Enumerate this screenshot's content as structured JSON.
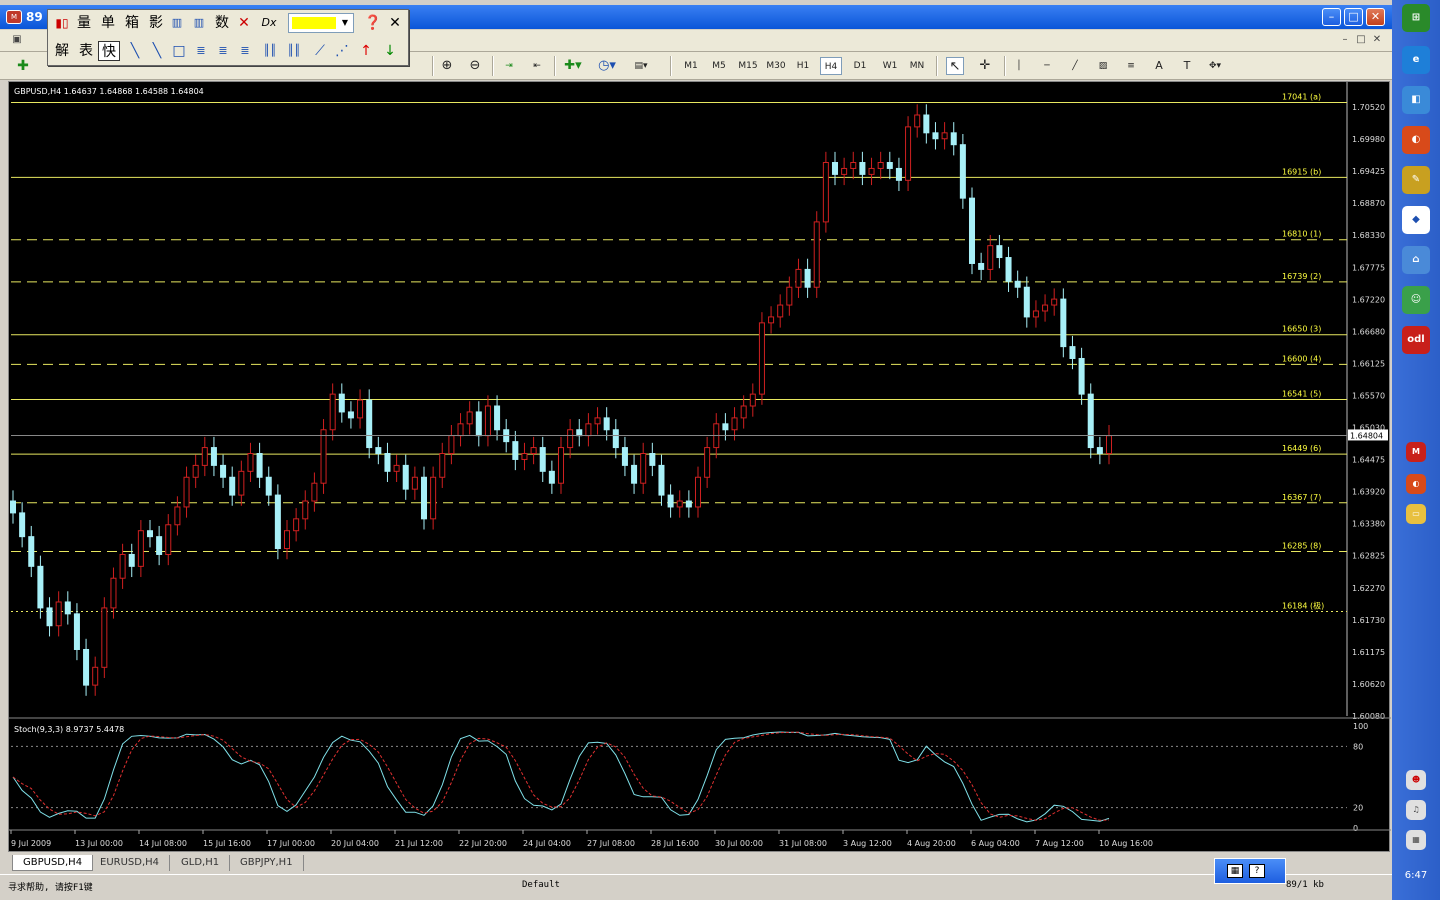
{
  "window": {
    "title": "89",
    "min": "–",
    "max": "□",
    "close": "✕"
  },
  "mdi": {
    "min": "–",
    "max": "□",
    "close": "✕"
  },
  "toolbar": {
    "timeframes": [
      "M1",
      "M5",
      "M15",
      "M30",
      "H1",
      "H4",
      "D1",
      "W1",
      "MN"
    ],
    "active_timeframe": "H4"
  },
  "float_toolbar": {
    "row1": [
      "量",
      "单",
      "箱",
      "影",
      "数"
    ],
    "row2": [
      "解",
      "表",
      "快"
    ],
    "active_row2": "快",
    "color": "#ffff00"
  },
  "chart": {
    "symbol_info": "GBPUSD,H4  1.64637 1.64868 1.64588 1.64804",
    "current_price": "1.64804",
    "price_axis": [
      "1.70520",
      "1.69980",
      "1.69425",
      "1.68870",
      "1.68330",
      "1.67775",
      "1.67220",
      "1.66680",
      "1.66125",
      "1.65570",
      "1.65030",
      "1.64475",
      "1.63920",
      "1.63380",
      "1.62825",
      "1.62270",
      "1.61730",
      "1.61175",
      "1.60620",
      "1.60080"
    ],
    "price_min": 1.6008,
    "price_max": 1.7052,
    "levels": [
      {
        "label": "17041 (a)",
        "price": 1.7041,
        "style": "solid"
      },
      {
        "label": "16915 (b)",
        "price": 1.6915,
        "style": "solid"
      },
      {
        "label": "16810 (1)",
        "price": 1.681,
        "style": "dash"
      },
      {
        "label": "16739 (2)",
        "price": 1.6739,
        "style": "dash"
      },
      {
        "label": "16650 (3)",
        "price": 1.665,
        "style": "solid"
      },
      {
        "label": "16600 (4)",
        "price": 1.66,
        "style": "dash"
      },
      {
        "label": "16541 (5)",
        "price": 1.6541,
        "style": "solid"
      },
      {
        "label": "16449 (6)",
        "price": 1.6449,
        "style": "solid"
      },
      {
        "label": "16367 (7)",
        "price": 1.6367,
        "style": "dash"
      },
      {
        "label": "16285 (8)",
        "price": 1.6285,
        "style": "dash"
      },
      {
        "label": "16184 (极)",
        "price": 1.6184,
        "style": "dot"
      }
    ],
    "closes": [
      1.635,
      1.631,
      1.626,
      1.619,
      1.616,
      1.62,
      1.618,
      1.612,
      1.606,
      1.609,
      1.619,
      1.624,
      1.628,
      1.626,
      1.632,
      1.631,
      1.628,
      1.633,
      1.636,
      1.641,
      1.643,
      1.646,
      1.643,
      1.641,
      1.638,
      1.642,
      1.645,
      1.641,
      1.638,
      1.629,
      1.632,
      1.634,
      1.637,
      1.64,
      1.649,
      1.655,
      1.652,
      1.651,
      1.654,
      1.646,
      1.645,
      1.642,
      1.643,
      1.639,
      1.641,
      1.634,
      1.641,
      1.645,
      1.648,
      1.65,
      1.652,
      1.648,
      1.653,
      1.649,
      1.647,
      1.644,
      1.645,
      1.646,
      1.642,
      1.64,
      1.646,
      1.649,
      1.648,
      1.65,
      1.651,
      1.649,
      1.646,
      1.643,
      1.64,
      1.645,
      1.643,
      1.638,
      1.636,
      1.637,
      1.636,
      1.641,
      1.646,
      1.65,
      1.649,
      1.651,
      1.653,
      1.655,
      1.667,
      1.668,
      1.67,
      1.673,
      1.676,
      1.673,
      1.684,
      1.694,
      1.692,
      1.693,
      1.694,
      1.692,
      1.693,
      1.694,
      1.693,
      1.691,
      1.7,
      1.702,
      1.699,
      1.698,
      1.699,
      1.697,
      1.688,
      1.677,
      1.676,
      1.68,
      1.678,
      1.674,
      1.673,
      1.668,
      1.669,
      1.67,
      1.671,
      1.663,
      1.661,
      1.655,
      1.646,
      1.645,
      1.648
    ],
    "time_labels": [
      "9 Jul 2009",
      "13 Jul 00:00",
      "14 Jul 08:00",
      "15 Jul 16:00",
      "17 Jul 00:00",
      "20 Jul 04:00",
      "21 Jul 12:00",
      "22 Jul 20:00",
      "24 Jul 04:00",
      "27 Jul 08:00",
      "28 Jul 16:00",
      "30 Jul 00:00",
      "31 Jul 08:00",
      "3 Aug 12:00",
      "4 Aug 20:00",
      "6 Aug 04:00",
      "7 Aug 12:00",
      "10 Aug 16:00"
    ],
    "stoch_info": "Stoch(9,3,3) 8.9737 5.4478",
    "stoch_axis": [
      "100",
      "80",
      "20",
      "0"
    ]
  },
  "tabs": [
    "GBPUSD,H4",
    "EURUSD,H4",
    "GLD,H1",
    "GBPJPY,H1"
  ],
  "active_tab": "GBPUSD,H4",
  "status": {
    "help": "寻求帮助, 请按F1键",
    "profile": "Default",
    "traffic": "89/1 kb"
  },
  "clock": "6:47"
}
